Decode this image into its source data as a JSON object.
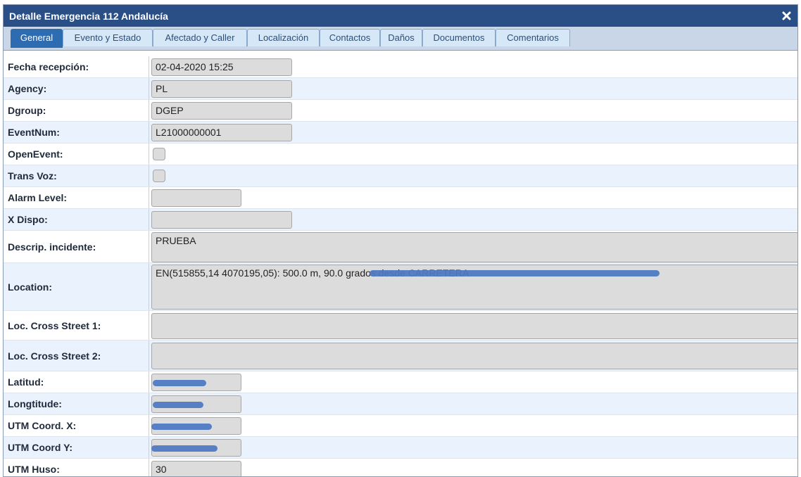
{
  "window": {
    "title": "Detalle Emergencia 112 Andalucía",
    "close_glyph": "✕"
  },
  "tabs": [
    {
      "label": "General",
      "active": true
    },
    {
      "label": "Evento y Estado"
    },
    {
      "label": "Afectado y Caller"
    },
    {
      "label": "Localización"
    },
    {
      "label": "Contactos"
    },
    {
      "label": "Daños"
    },
    {
      "label": "Documentos"
    },
    {
      "label": "Comentarios"
    }
  ],
  "fields": {
    "fecha": {
      "label": "Fecha recepción:",
      "value": "02-04-2020 15:25"
    },
    "agency": {
      "label": "Agency:",
      "value": "PL"
    },
    "dgroup": {
      "label": "Dgroup:",
      "value": "DGEP"
    },
    "eventnum": {
      "label": "EventNum:",
      "value": "L21000000001"
    },
    "openevent": {
      "label": "OpenEvent:",
      "checked": false
    },
    "transvoz": {
      "label": "Trans Voz:",
      "checked": false
    },
    "alarm": {
      "label": "Alarm Level:",
      "value": ""
    },
    "xdispo": {
      "label": "X Dispo:",
      "value": ""
    },
    "descrip": {
      "label": "Descrip. incidente:",
      "value": "PRUEBA"
    },
    "location": {
      "label": "Location:",
      "value": "EN(515855,14 4070195,05): 500.0 m, 90.0 grados desde CARRETERA"
    },
    "cross1": {
      "label": "Loc. Cross Street 1:",
      "value": ""
    },
    "cross2": {
      "label": "Loc. Cross Street 2:",
      "value": ""
    },
    "latitud": {
      "label": "Latitud:",
      "value": ""
    },
    "longitud": {
      "label": "Longtitude:",
      "value": ""
    },
    "utmx": {
      "label": "UTM Coord. X:",
      "value": ""
    },
    "utmy": {
      "label": "UTM Coord Y:",
      "value": ""
    },
    "utmhuso": {
      "label": "UTM Huso:",
      "value": "30"
    }
  },
  "colors": {
    "titlebar": "#2a4f86",
    "active_tab": "#2d6cb0",
    "row_alt": "#eaf3fd",
    "redaction": "#4f79c2"
  }
}
